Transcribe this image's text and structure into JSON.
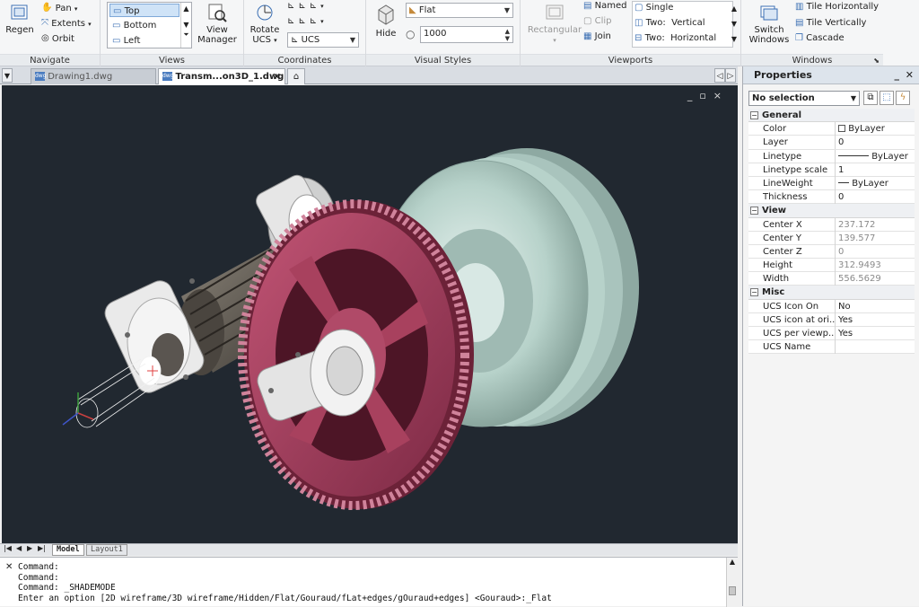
{
  "ribbon": {
    "navigate": {
      "title": "Navigate",
      "regen": "Regen",
      "pan": "Pan",
      "extents": "Extents",
      "orbit": "Orbit"
    },
    "views": {
      "title": "Views",
      "items": [
        "Top",
        "Bottom",
        "Left"
      ],
      "selected": "Top",
      "manager_line1": "View",
      "manager_line2": "Manager"
    },
    "coordinates": {
      "title": "Coordinates",
      "rotate_line1": "Rotate",
      "rotate_line2": "UCS",
      "ucs_combo": "UCS"
    },
    "visual_styles": {
      "title": "Visual Styles",
      "hide": "Hide",
      "style_combo": "Flat",
      "value_input": "1000"
    },
    "viewports": {
      "title": "Viewports",
      "rectangular": "Rectangular",
      "named": "Named",
      "clip": "Clip",
      "join": "Join",
      "single": "Single",
      "two_vertical_a": "Two:",
      "two_vertical_b": "Vertical",
      "two_horizontal_a": "Two:",
      "two_horizontal_b": "Horizontal"
    },
    "windows": {
      "title": "Windows",
      "switch_line1": "Switch",
      "switch_line2": "Windows",
      "tile_h": "Tile Horizontally",
      "tile_v": "Tile Vertically",
      "cascade": "Cascade"
    }
  },
  "tabs": [
    {
      "label": "Drawing1.dwg",
      "active": false
    },
    {
      "label": "Transm...on3D_1.dwg",
      "active": true
    }
  ],
  "viewport_controls": {
    "min": "_",
    "restore": "▫",
    "close": "×"
  },
  "properties": {
    "title": "Properties",
    "selection": "No selection",
    "categories": [
      {
        "name": "General",
        "rows": [
          {
            "key": "Color",
            "value": "ByLayer"
          },
          {
            "key": "Layer",
            "value": "0"
          },
          {
            "key": "Linetype",
            "value": "ByLayer"
          },
          {
            "key": "Linetype scale",
            "value": "1"
          },
          {
            "key": "LineWeight",
            "value": "ByLayer"
          },
          {
            "key": "Thickness",
            "value": "0"
          }
        ]
      },
      {
        "name": "View",
        "rows": [
          {
            "key": "Center X",
            "value": "237.172"
          },
          {
            "key": "Center Y",
            "value": "139.577"
          },
          {
            "key": "Center Z",
            "value": "0"
          },
          {
            "key": "Height",
            "value": "312.9493"
          },
          {
            "key": "Width",
            "value": "556.5629"
          }
        ]
      },
      {
        "name": "Misc",
        "rows": [
          {
            "key": "UCS Icon On",
            "value": "No"
          },
          {
            "key": "UCS icon at ori...",
            "value": "Yes"
          },
          {
            "key": "UCS per viewp...",
            "value": "Yes"
          },
          {
            "key": "UCS Name",
            "value": ""
          }
        ]
      }
    ]
  },
  "layout_tabs": {
    "model": "Model",
    "layout1": "Layout1"
  },
  "command_line": {
    "lines": [
      "Command:",
      "Command:",
      "Command: _SHADEMODE",
      "Enter an option [2D wireframe/3D wireframe/Hidden/Flat/Gouraud/fLat+edges/gOuraud+edges] <Gouraud>:_Flat"
    ]
  },
  "colors": {
    "viewport_bg": "#212830",
    "gear": "#a8415e",
    "pulley": "#b7d2ca",
    "shaft": "#5f5a52"
  }
}
